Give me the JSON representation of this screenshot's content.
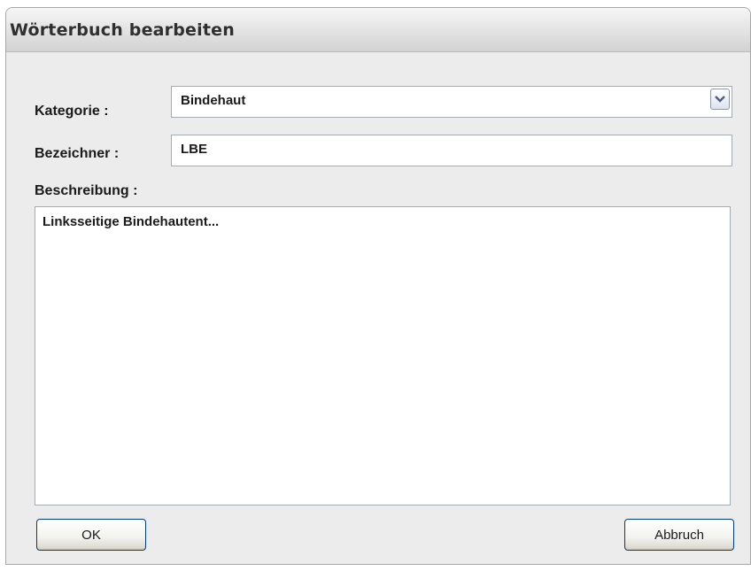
{
  "window": {
    "title": "Wörterbuch bearbeiten"
  },
  "form": {
    "kategorie_label": "Kategorie :",
    "kategorie_value": "Bindehaut",
    "bezeichner_label": "Bezeichner :",
    "bezeichner_value": "LBE",
    "beschreibung_label": "Beschreibung :",
    "beschreibung_value": "Linksseitige Bindehautent..."
  },
  "buttons": {
    "ok_label": "OK",
    "cancel_label": "Abbruch"
  },
  "icons": {
    "dropdown": "chevron-down-icon"
  }
}
